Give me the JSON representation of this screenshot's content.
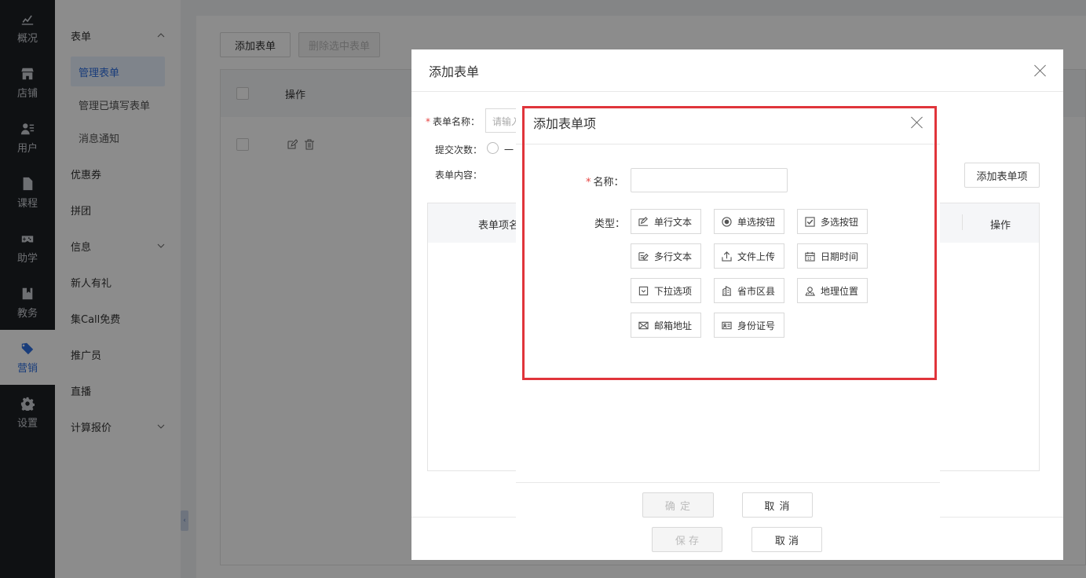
{
  "leftnav": [
    {
      "label": "概况",
      "icon": "chart-icon"
    },
    {
      "label": "店铺",
      "icon": "store-icon"
    },
    {
      "label": "用户",
      "icon": "users-icon"
    },
    {
      "label": "课程",
      "icon": "document-icon"
    },
    {
      "label": "助学",
      "icon": "gamepad-icon"
    },
    {
      "label": "教务",
      "icon": "bookmark-icon"
    },
    {
      "label": "营销",
      "icon": "tag-icon",
      "active": true
    },
    {
      "label": "设置",
      "icon": "gear-icon"
    }
  ],
  "subnav": {
    "group_form": "表单",
    "children": [
      "管理表单",
      "管理已填写表单",
      "消息通知"
    ],
    "items": [
      "优惠券",
      "拼团",
      "信息",
      "新人有礼",
      "集Call免费",
      "推广员",
      "直播",
      "计算报价"
    ]
  },
  "page": {
    "add_form_btn": "添加表单",
    "delete_selected_btn": "删除选中表单",
    "table_header_op": "操作"
  },
  "dialog1": {
    "title": "添加表单",
    "name_label": "表单名称：",
    "name_placeholder": "请输入",
    "submit_times_label": "提交次数：",
    "submit_times_option": "一",
    "content_label": "表单内容：",
    "add_item_btn": "添加表单项",
    "col_item_name": "表单项名",
    "col_op": "操作",
    "save_btn": "保 存",
    "cancel_btn": "取 消"
  },
  "dialog2": {
    "title": "添加表单项",
    "name_label": "名称：",
    "type_label": "类型：",
    "types": [
      {
        "label": "单行文本",
        "icon": "single-line-icon"
      },
      {
        "label": "单选按钮",
        "icon": "radio-icon"
      },
      {
        "label": "多选按钮",
        "icon": "checkbox-icon"
      },
      {
        "label": "多行文本",
        "icon": "multi-line-icon"
      },
      {
        "label": "文件上传",
        "icon": "upload-icon"
      },
      {
        "label": "日期时间",
        "icon": "calendar-icon"
      },
      {
        "label": "下拉选项",
        "icon": "dropdown-icon"
      },
      {
        "label": "省市区县",
        "icon": "building-icon"
      },
      {
        "label": "地理位置",
        "icon": "location-icon"
      },
      {
        "label": "邮箱地址",
        "icon": "mail-icon"
      },
      {
        "label": "身份证号",
        "icon": "id-card-icon"
      }
    ],
    "confirm_btn": "确 定",
    "cancel_btn": "取 消"
  },
  "colors": {
    "accent": "#2f6fe0",
    "highlight_border": "#e0343b",
    "nav_bg": "#1c1f24"
  }
}
